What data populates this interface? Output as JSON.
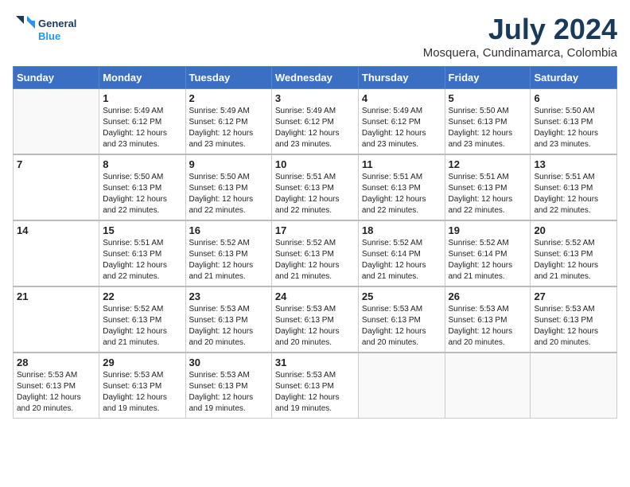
{
  "header": {
    "logo_line1": "General",
    "logo_line2": "Blue",
    "month_year": "July 2024",
    "location": "Mosquera, Cundinamarca, Colombia"
  },
  "days_of_week": [
    "Sunday",
    "Monday",
    "Tuesday",
    "Wednesday",
    "Thursday",
    "Friday",
    "Saturday"
  ],
  "weeks": [
    [
      {
        "day": "",
        "info": ""
      },
      {
        "day": "1",
        "info": "Sunrise: 5:49 AM\nSunset: 6:12 PM\nDaylight: 12 hours\nand 23 minutes."
      },
      {
        "day": "2",
        "info": "Sunrise: 5:49 AM\nSunset: 6:12 PM\nDaylight: 12 hours\nand 23 minutes."
      },
      {
        "day": "3",
        "info": "Sunrise: 5:49 AM\nSunset: 6:12 PM\nDaylight: 12 hours\nand 23 minutes."
      },
      {
        "day": "4",
        "info": "Sunrise: 5:49 AM\nSunset: 6:12 PM\nDaylight: 12 hours\nand 23 minutes."
      },
      {
        "day": "5",
        "info": "Sunrise: 5:50 AM\nSunset: 6:13 PM\nDaylight: 12 hours\nand 23 minutes."
      },
      {
        "day": "6",
        "info": "Sunrise: 5:50 AM\nSunset: 6:13 PM\nDaylight: 12 hours\nand 23 minutes."
      }
    ],
    [
      {
        "day": "7",
        "info": ""
      },
      {
        "day": "8",
        "info": "Sunrise: 5:50 AM\nSunset: 6:13 PM\nDaylight: 12 hours\nand 22 minutes."
      },
      {
        "day": "9",
        "info": "Sunrise: 5:50 AM\nSunset: 6:13 PM\nDaylight: 12 hours\nand 22 minutes."
      },
      {
        "day": "10",
        "info": "Sunrise: 5:51 AM\nSunset: 6:13 PM\nDaylight: 12 hours\nand 22 minutes."
      },
      {
        "day": "11",
        "info": "Sunrise: 5:51 AM\nSunset: 6:13 PM\nDaylight: 12 hours\nand 22 minutes."
      },
      {
        "day": "12",
        "info": "Sunrise: 5:51 AM\nSunset: 6:13 PM\nDaylight: 12 hours\nand 22 minutes."
      },
      {
        "day": "13",
        "info": "Sunrise: 5:51 AM\nSunset: 6:13 PM\nDaylight: 12 hours\nand 22 minutes."
      }
    ],
    [
      {
        "day": "14",
        "info": ""
      },
      {
        "day": "15",
        "info": "Sunrise: 5:51 AM\nSunset: 6:13 PM\nDaylight: 12 hours\nand 22 minutes."
      },
      {
        "day": "16",
        "info": "Sunrise: 5:52 AM\nSunset: 6:13 PM\nDaylight: 12 hours\nand 21 minutes."
      },
      {
        "day": "17",
        "info": "Sunrise: 5:52 AM\nSunset: 6:13 PM\nDaylight: 12 hours\nand 21 minutes."
      },
      {
        "day": "18",
        "info": "Sunrise: 5:52 AM\nSunset: 6:14 PM\nDaylight: 12 hours\nand 21 minutes."
      },
      {
        "day": "19",
        "info": "Sunrise: 5:52 AM\nSunset: 6:14 PM\nDaylight: 12 hours\nand 21 minutes."
      },
      {
        "day": "20",
        "info": "Sunrise: 5:52 AM\nSunset: 6:13 PM\nDaylight: 12 hours\nand 21 minutes."
      }
    ],
    [
      {
        "day": "21",
        "info": ""
      },
      {
        "day": "22",
        "info": "Sunrise: 5:52 AM\nSunset: 6:13 PM\nDaylight: 12 hours\nand 21 minutes."
      },
      {
        "day": "23",
        "info": "Sunrise: 5:53 AM\nSunset: 6:13 PM\nDaylight: 12 hours\nand 20 minutes."
      },
      {
        "day": "24",
        "info": "Sunrise: 5:53 AM\nSunset: 6:13 PM\nDaylight: 12 hours\nand 20 minutes."
      },
      {
        "day": "25",
        "info": "Sunrise: 5:53 AM\nSunset: 6:13 PM\nDaylight: 12 hours\nand 20 minutes."
      },
      {
        "day": "26",
        "info": "Sunrise: 5:53 AM\nSunset: 6:13 PM\nDaylight: 12 hours\nand 20 minutes."
      },
      {
        "day": "27",
        "info": "Sunrise: 5:53 AM\nSunset: 6:13 PM\nDaylight: 12 hours\nand 20 minutes."
      }
    ],
    [
      {
        "day": "28",
        "info": "Sunrise: 5:53 AM\nSunset: 6:13 PM\nDaylight: 12 hours\nand 20 minutes."
      },
      {
        "day": "29",
        "info": "Sunrise: 5:53 AM\nSunset: 6:13 PM\nDaylight: 12 hours\nand 19 minutes."
      },
      {
        "day": "30",
        "info": "Sunrise: 5:53 AM\nSunset: 6:13 PM\nDaylight: 12 hours\nand 19 minutes."
      },
      {
        "day": "31",
        "info": "Sunrise: 5:53 AM\nSunset: 6:13 PM\nDaylight: 12 hours\nand 19 minutes."
      },
      {
        "day": "",
        "info": ""
      },
      {
        "day": "",
        "info": ""
      },
      {
        "day": "",
        "info": ""
      }
    ]
  ]
}
